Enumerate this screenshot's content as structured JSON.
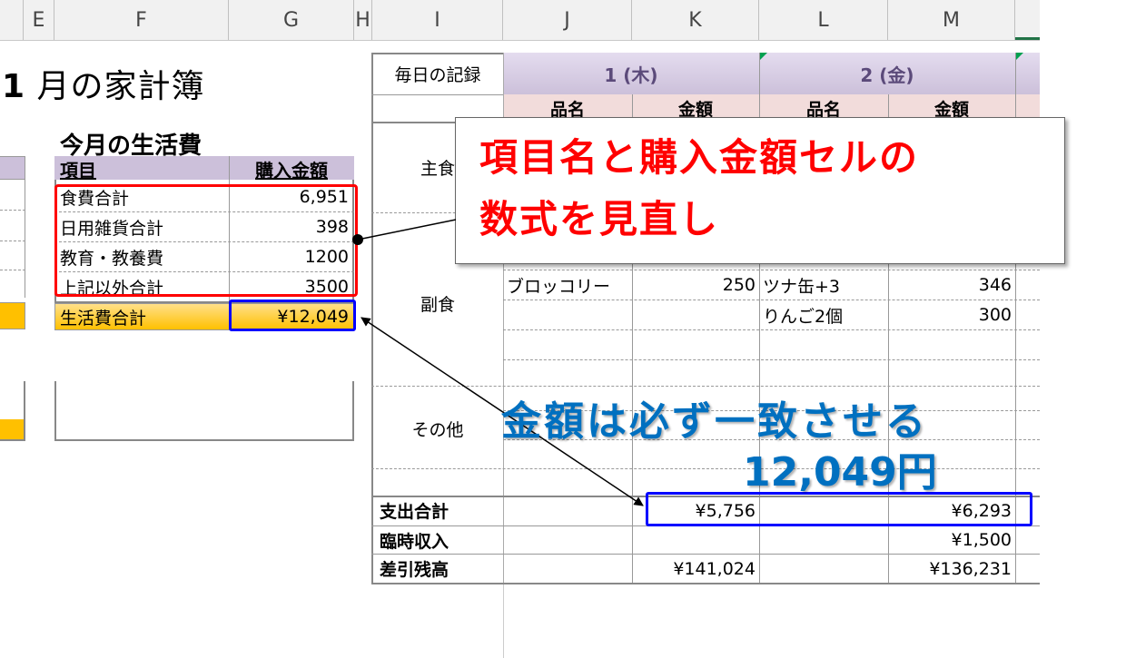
{
  "column_headers": [
    "E",
    "F",
    "G",
    "H",
    "I",
    "J",
    "K",
    "L",
    "M"
  ],
  "title": {
    "month": "1",
    "rest": " 月の家計簿"
  },
  "living_costs": {
    "heading": "今月の生活費",
    "col_item": "項目",
    "col_amount": "購入金額",
    "rows": [
      {
        "item": "食費合計",
        "amount": "6,951"
      },
      {
        "item": "日用雑貨合計",
        "amount": "398"
      },
      {
        "item": "教育・教養費",
        "amount": "1200"
      },
      {
        "item": "上記以外合計",
        "amount": "3500"
      }
    ],
    "total_label": "生活費合計",
    "total_value": "¥12,049"
  },
  "daily": {
    "header_label": "毎日の記録",
    "day1": "1 (木)",
    "day2": "2 (金)",
    "sub_item": "品名",
    "sub_amount": "金額",
    "row_staple": "主食",
    "row_side": "副食",
    "row_other": "その他",
    "side_items": [
      {
        "k_item": "ブロッコリー",
        "k_amount": "250",
        "m_item": "ツナ缶+3",
        "m_amount": "346"
      },
      {
        "k_item": "",
        "k_amount": "",
        "m_item": "りんご2個",
        "m_amount": "300"
      }
    ],
    "expense_total_label": "支出合計",
    "expense_day1": "¥5,756",
    "expense_day2": "¥6,293",
    "temp_income_label": "臨時収入",
    "temp_income_day2": "¥1,500",
    "balance_label": "差引残高",
    "balance_day1": "¥141,024",
    "balance_day2": "¥136,231"
  },
  "annotations": {
    "callout_line1": "項目名と購入金額セルの",
    "callout_line2": "数式を見直し",
    "blue_line1": "金額は必ず一致させる",
    "blue_line2": "12,049円"
  },
  "colors": {
    "header_purple": "#ccc0da",
    "total_yellow": "#ffc000",
    "pink_header": "#f2dcdb",
    "red_box": "#ff0000",
    "blue_box": "#0000ff",
    "red_text": "#ff0000",
    "blue_text": "#0070c0"
  }
}
